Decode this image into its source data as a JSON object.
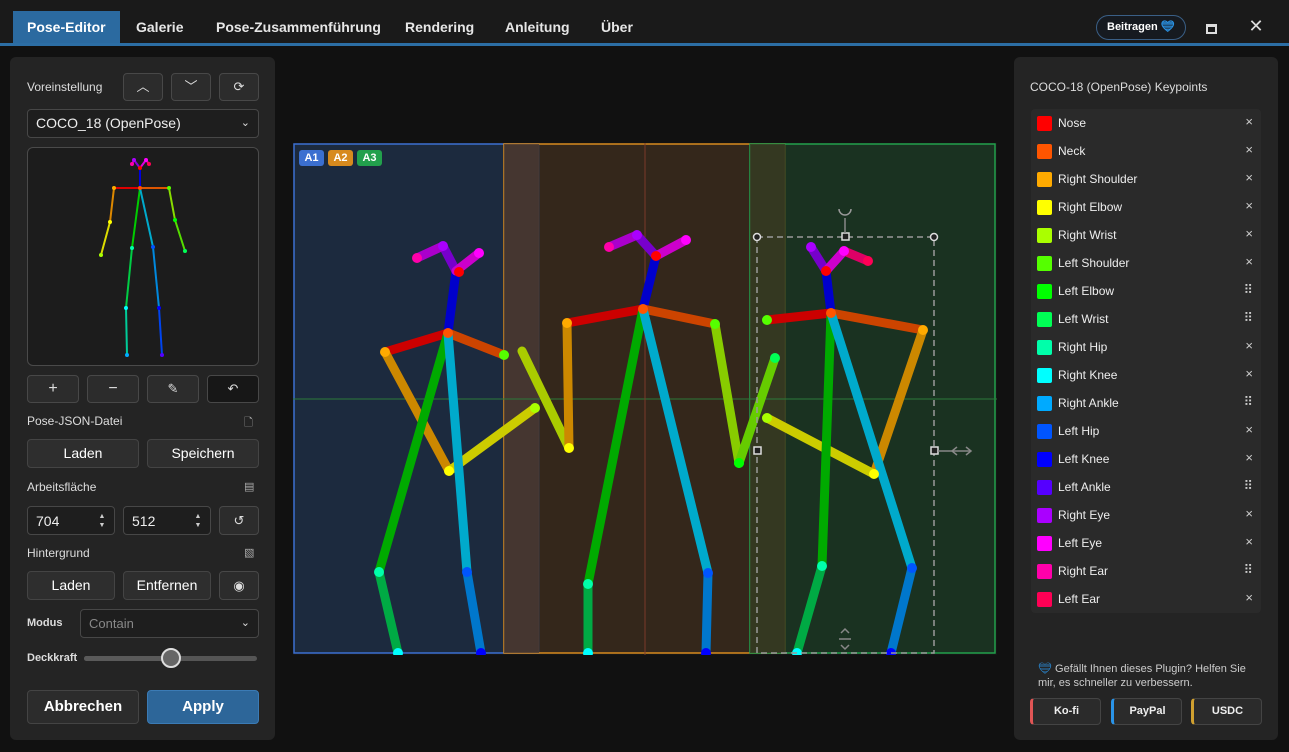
{
  "tabs": [
    "Pose-Editor",
    "Galerie",
    "Pose-Zusammenführung",
    "Rendering",
    "Anleitung",
    "Über"
  ],
  "donate_label": "Beitragen",
  "left": {
    "preset_label": "Voreinstellung",
    "preset_value": "COCO_18 (OpenPose)",
    "json_label": "Pose-JSON-Datei",
    "load": "Laden",
    "save": "Speichern",
    "canvas_label": "Arbeitsfläche",
    "width": "704",
    "height": "512",
    "bg_label": "Hintergrund",
    "bg_load": "Laden",
    "bg_remove": "Entfernen",
    "mode_label": "Modus",
    "mode_value": "Contain",
    "opacity_label": "Deckkraft",
    "opacity": 0.5,
    "cancel": "Abbrechen",
    "apply": "Apply"
  },
  "canvas": {
    "areas": [
      "A1",
      "A2",
      "A3"
    ],
    "area_colors": [
      "#3b6fd0",
      "#d78a1e",
      "#22a04c"
    ]
  },
  "right": {
    "title": "COCO-18 (OpenPose) Keypoints",
    "keypoints": [
      {
        "name": "Nose",
        "color": "#ff0000",
        "action": "×"
      },
      {
        "name": "Neck",
        "color": "#ff5500",
        "action": "×"
      },
      {
        "name": "Right Shoulder",
        "color": "#ffaa00",
        "action": "×"
      },
      {
        "name": "Right Elbow",
        "color": "#ffff00",
        "action": "×"
      },
      {
        "name": "Right Wrist",
        "color": "#aaff00",
        "action": "×"
      },
      {
        "name": "Left Shoulder",
        "color": "#55ff00",
        "action": "×"
      },
      {
        "name": "Left Elbow",
        "color": "#00ff00",
        "action": "⠿"
      },
      {
        "name": "Left Wrist",
        "color": "#00ff55",
        "action": "⠿"
      },
      {
        "name": "Right Hip",
        "color": "#00ffaa",
        "action": "×"
      },
      {
        "name": "Right Knee",
        "color": "#00ffff",
        "action": "×"
      },
      {
        "name": "Right Ankle",
        "color": "#00aaff",
        "action": "⠿"
      },
      {
        "name": "Left Hip",
        "color": "#0055ff",
        "action": "×"
      },
      {
        "name": "Left Knee",
        "color": "#0000ff",
        "action": "×"
      },
      {
        "name": "Left Ankle",
        "color": "#5500ff",
        "action": "⠿"
      },
      {
        "name": "Right Eye",
        "color": "#aa00ff",
        "action": "×"
      },
      {
        "name": "Left Eye",
        "color": "#ff00ff",
        "action": "×"
      },
      {
        "name": "Right Ear",
        "color": "#ff00aa",
        "action": "⠿"
      },
      {
        "name": "Left Ear",
        "color": "#ff0055",
        "action": "×"
      }
    ],
    "support_text": "Gefällt Ihnen dieses Plugin? Helfen Sie mir, es schneller zu verbessern.",
    "payments": [
      {
        "label": "Ko-fi",
        "color": "#e05555"
      },
      {
        "label": "PayPal",
        "color": "#2a94e8"
      },
      {
        "label": "USDC",
        "color": "#d0a030"
      }
    ]
  }
}
